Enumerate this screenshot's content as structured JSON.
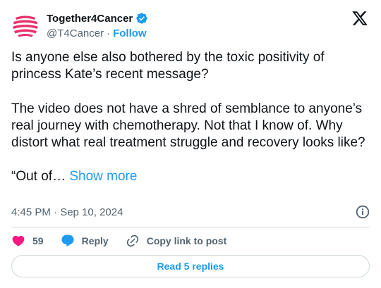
{
  "author": {
    "display_name": "Together4Cancer",
    "handle": "@T4Cancer",
    "separator": "·",
    "follow_label": "Follow",
    "brand_color": "#e8316b"
  },
  "tweet": {
    "paragraph_1": "Is anyone else also bothered by the toxic positivity of princess Kate’s recent message?",
    "paragraph_2": "The video does not have a shred of semblance to anyone’s real journey with chemotherapy. Not that I know of. Why distort what real treatment struggle and recovery looks like?",
    "paragraph_3": "“Out of…",
    "show_more_label": "Show more"
  },
  "meta": {
    "timestamp": "4:45 PM · Sep 10, 2024"
  },
  "actions": {
    "like_count": "59",
    "reply_label": "Reply",
    "copy_label": "Copy link to post"
  },
  "replies": {
    "read_label": "Read 5 replies"
  },
  "colors": {
    "accent": "#1d9bf0",
    "like": "#f91880",
    "text": "#0f1419",
    "muted": "#536471",
    "border": "#cfd9de"
  },
  "icons": [
    "brand-stripes-avatar",
    "verified-badge-icon",
    "x-logo-icon",
    "info-icon",
    "heart-icon",
    "reply-bubble-icon",
    "link-icon"
  ]
}
